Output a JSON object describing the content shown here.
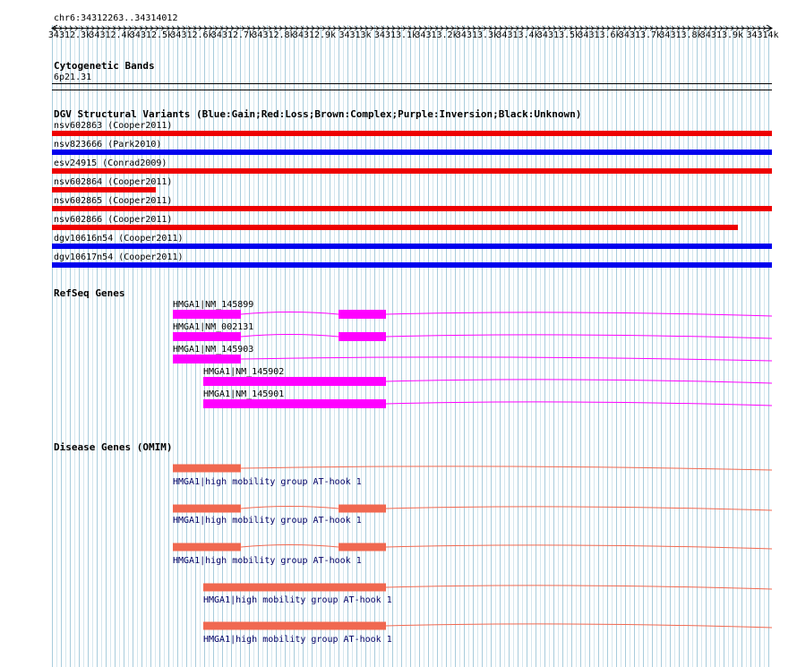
{
  "browser": {
    "locus": "chr6:34312263..34314012",
    "tick_labels": [
      "34312.3k",
      "34312.4k",
      "34312.5k",
      "34312.6k",
      "34312.7k",
      "34312.8k",
      "34312.9k",
      "34313k",
      "34313.1k",
      "34313.2k",
      "34313.3k",
      "34313.4k",
      "34313.5k",
      "34313.6k",
      "34313.7k",
      "34313.8k",
      "34313.9k",
      "34314k"
    ]
  },
  "tracks": {
    "cytoband": {
      "title": "Cytogenetic Bands",
      "band": "6p21.31"
    },
    "dgv": {
      "title": "DGV Structural Variants (Blue:Gain;Red:Loss;Brown:Complex;Purple:Inversion;Black:Unknown)",
      "colors": {
        "gain": "#0000ee",
        "loss": "#ee0000"
      },
      "items": [
        {
          "label": "nsv602863 (Cooper2011)",
          "type": "loss"
        },
        {
          "label": "nsv823666 (Park2010)",
          "type": "gain"
        },
        {
          "label": "esv24915 (Conrad2009)",
          "type": "loss"
        },
        {
          "label": "nsv602864 (Cooper2011)",
          "type": "loss"
        },
        {
          "label": "nsv602865 (Cooper2011)",
          "type": "loss"
        },
        {
          "label": "nsv602866 (Cooper2011)",
          "type": "loss"
        },
        {
          "label": "dgv10616n54 (Cooper2011)",
          "type": "gain"
        },
        {
          "label": "dgv10617n54 (Cooper2011)",
          "type": "gain"
        }
      ]
    },
    "refseq": {
      "title": "RefSeq Genes",
      "color": "#ff00ff",
      "items": [
        {
          "label": "HMGA1|NM_145899"
        },
        {
          "label": "HMGA1|NM_002131"
        },
        {
          "label": "HMGA1|NM_145903"
        },
        {
          "label": "HMGA1|NM_145902"
        },
        {
          "label": "HMGA1|NM_145901"
        }
      ]
    },
    "omim": {
      "title": "Disease Genes (OMIM)",
      "color": "#f06850",
      "items": [
        {
          "label": "HMGA1|high mobility group AT-hook 1"
        },
        {
          "label": "HMGA1|high mobility group AT-hook 1"
        },
        {
          "label": "HMGA1|high mobility group AT-hook 1"
        },
        {
          "label": "HMGA1|high mobility group AT-hook 1"
        },
        {
          "label": "HMGA1|high mobility group AT-hook 1"
        }
      ]
    }
  }
}
